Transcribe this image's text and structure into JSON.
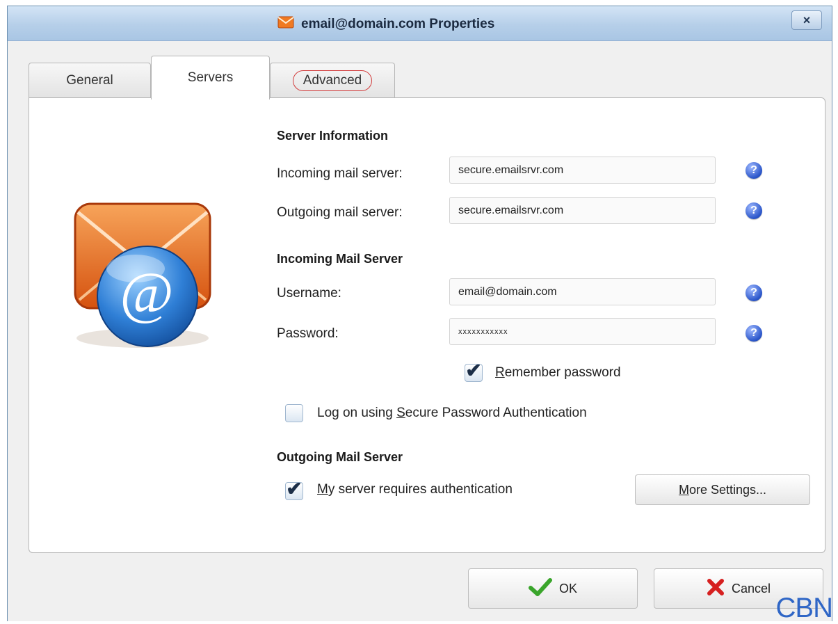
{
  "window": {
    "title": "email@domain.com Properties",
    "close_label": "×"
  },
  "tabs": [
    {
      "label": "General",
      "active": false
    },
    {
      "label": "Servers",
      "active": true
    },
    {
      "label": "Advanced",
      "active": false,
      "highlighted": true
    }
  ],
  "server_information": {
    "heading": "Server Information",
    "incoming_label": "Incoming mail server:",
    "incoming_value": "secure.emailsrvr.com",
    "outgoing_label": "Outgoing mail server:",
    "outgoing_value": "secure.emailsrvr.com"
  },
  "incoming_mail_server": {
    "heading": "Incoming Mail Server",
    "username_label": "Username:",
    "username_value": "email@domain.com",
    "password_label": "Password:",
    "password_value": "xxxxxxxxxxx",
    "remember_password_prefix": "R",
    "remember_password_rest": "emember password",
    "remember_password_checked": true,
    "spa_prefix": "Log on using ",
    "spa_mnemonic": "S",
    "spa_rest": "ecure Password Authentication",
    "spa_checked": false
  },
  "outgoing_mail_server": {
    "heading": "Outgoing Mail Server",
    "auth_mnemonic": "M",
    "auth_rest": "y server requires authentication",
    "auth_checked": true,
    "more_settings_mnemonic": "M",
    "more_settings_rest": "ore Settings..."
  },
  "help_glyph": "?",
  "check_glyph": "✔",
  "logo_glyph": "@",
  "buttons": {
    "ok_label": "OK",
    "cancel_label": "Cancel"
  },
  "watermark": "CBN",
  "icons": {
    "title_icon": "envelope-icon",
    "help_icon": "question-icon",
    "ok_icon": "checkmark-icon",
    "cancel_icon": "red-x-icon",
    "logo_icon": "email-at-icon"
  },
  "colors": {
    "highlight_ring": "#d23b3b",
    "help_blue": "#2a55c9",
    "ok_green": "#3aa52b",
    "cancel_red": "#d62020",
    "envelope_orange": "#e86f1c"
  }
}
